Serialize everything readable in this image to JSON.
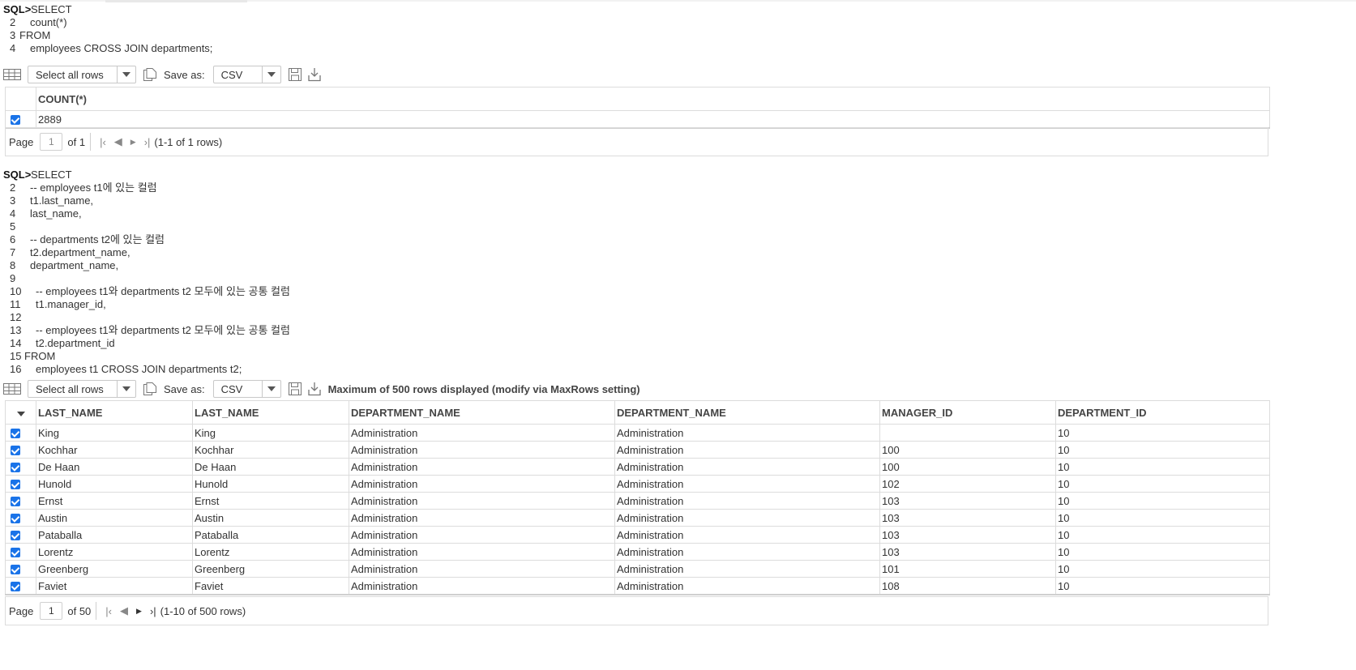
{
  "prompt": "SQL>",
  "query1": {
    "lines": [
      {
        "no": "",
        "text": "SELECT"
      },
      {
        "no": "2",
        "text": "count(*)"
      },
      {
        "no": "3",
        "text": "FROM"
      },
      {
        "no": "4",
        "text": "employees CROSS JOIN departments;"
      }
    ],
    "toolbar": {
      "select_value": "Select all rows",
      "save_as_label": "Save as:",
      "format_value": "CSV"
    },
    "columns": [
      "COUNT(*)"
    ],
    "rows": [
      [
        "2889"
      ]
    ],
    "pager": {
      "page_label": "Page",
      "page_value": "1",
      "of_text": "of 1",
      "range_text": "(1-1 of 1 rows)"
    }
  },
  "query2": {
    "lines": [
      {
        "no": "",
        "text": "SELECT"
      },
      {
        "no": "2",
        "text": "-- employees t1에 있는 컬럼"
      },
      {
        "no": "3",
        "text": "t1.last_name,"
      },
      {
        "no": "4",
        "text": "last_name,"
      },
      {
        "no": "5",
        "text": ""
      },
      {
        "no": "6",
        "text": "-- departments t2에 있는 컬럼"
      },
      {
        "no": "7",
        "text": "t2.department_name,"
      },
      {
        "no": "8",
        "text": "department_name,"
      },
      {
        "no": "9",
        "text": ""
      },
      {
        "no": "10",
        "text": "-- employees t1와 departments t2 모두에 있는 공통 컬럼"
      },
      {
        "no": "11",
        "text": "t1.manager_id,"
      },
      {
        "no": "12",
        "text": ""
      },
      {
        "no": "13",
        "text": "-- employees t1와 departments t2 모두에 있는 공통 컬럼"
      },
      {
        "no": "14",
        "text": "t2.department_id"
      },
      {
        "no": "15",
        "text": "FROM"
      },
      {
        "no": "16",
        "text": "employees t1 CROSS JOIN departments t2;"
      }
    ],
    "toolbar": {
      "select_value": "Select all rows",
      "save_as_label": "Save as:",
      "format_value": "CSV",
      "max_rows_note": "Maximum of 500 rows displayed (modify via MaxRows setting)"
    },
    "columns": [
      "LAST_NAME",
      "LAST_NAME",
      "DEPARTMENT_NAME",
      "DEPARTMENT_NAME",
      "MANAGER_ID",
      "DEPARTMENT_ID"
    ],
    "rows": [
      [
        "King",
        "King",
        "Administration",
        "Administration",
        "",
        "10"
      ],
      [
        "Kochhar",
        "Kochhar",
        "Administration",
        "Administration",
        "100",
        "10"
      ],
      [
        "De Haan",
        "De Haan",
        "Administration",
        "Administration",
        "100",
        "10"
      ],
      [
        "Hunold",
        "Hunold",
        "Administration",
        "Administration",
        "102",
        "10"
      ],
      [
        "Ernst",
        "Ernst",
        "Administration",
        "Administration",
        "103",
        "10"
      ],
      [
        "Austin",
        "Austin",
        "Administration",
        "Administration",
        "103",
        "10"
      ],
      [
        "Pataballa",
        "Pataballa",
        "Administration",
        "Administration",
        "103",
        "10"
      ],
      [
        "Lorentz",
        "Lorentz",
        "Administration",
        "Administration",
        "103",
        "10"
      ],
      [
        "Greenberg",
        "Greenberg",
        "Administration",
        "Administration",
        "101",
        "10"
      ],
      [
        "Faviet",
        "Faviet",
        "Administration",
        "Administration",
        "108",
        "10"
      ]
    ],
    "pager": {
      "page_label": "Page",
      "page_value": "1",
      "of_text": "of 50",
      "range_text": "(1-10 of 500 rows)"
    }
  },
  "icons": [
    "grid-icon",
    "chevron-down-icon",
    "copy-icon",
    "save-icon",
    "download-icon",
    "first-page-icon",
    "prev-page-icon",
    "next-page-icon",
    "last-page-icon",
    "checkbox-checked-icon"
  ]
}
